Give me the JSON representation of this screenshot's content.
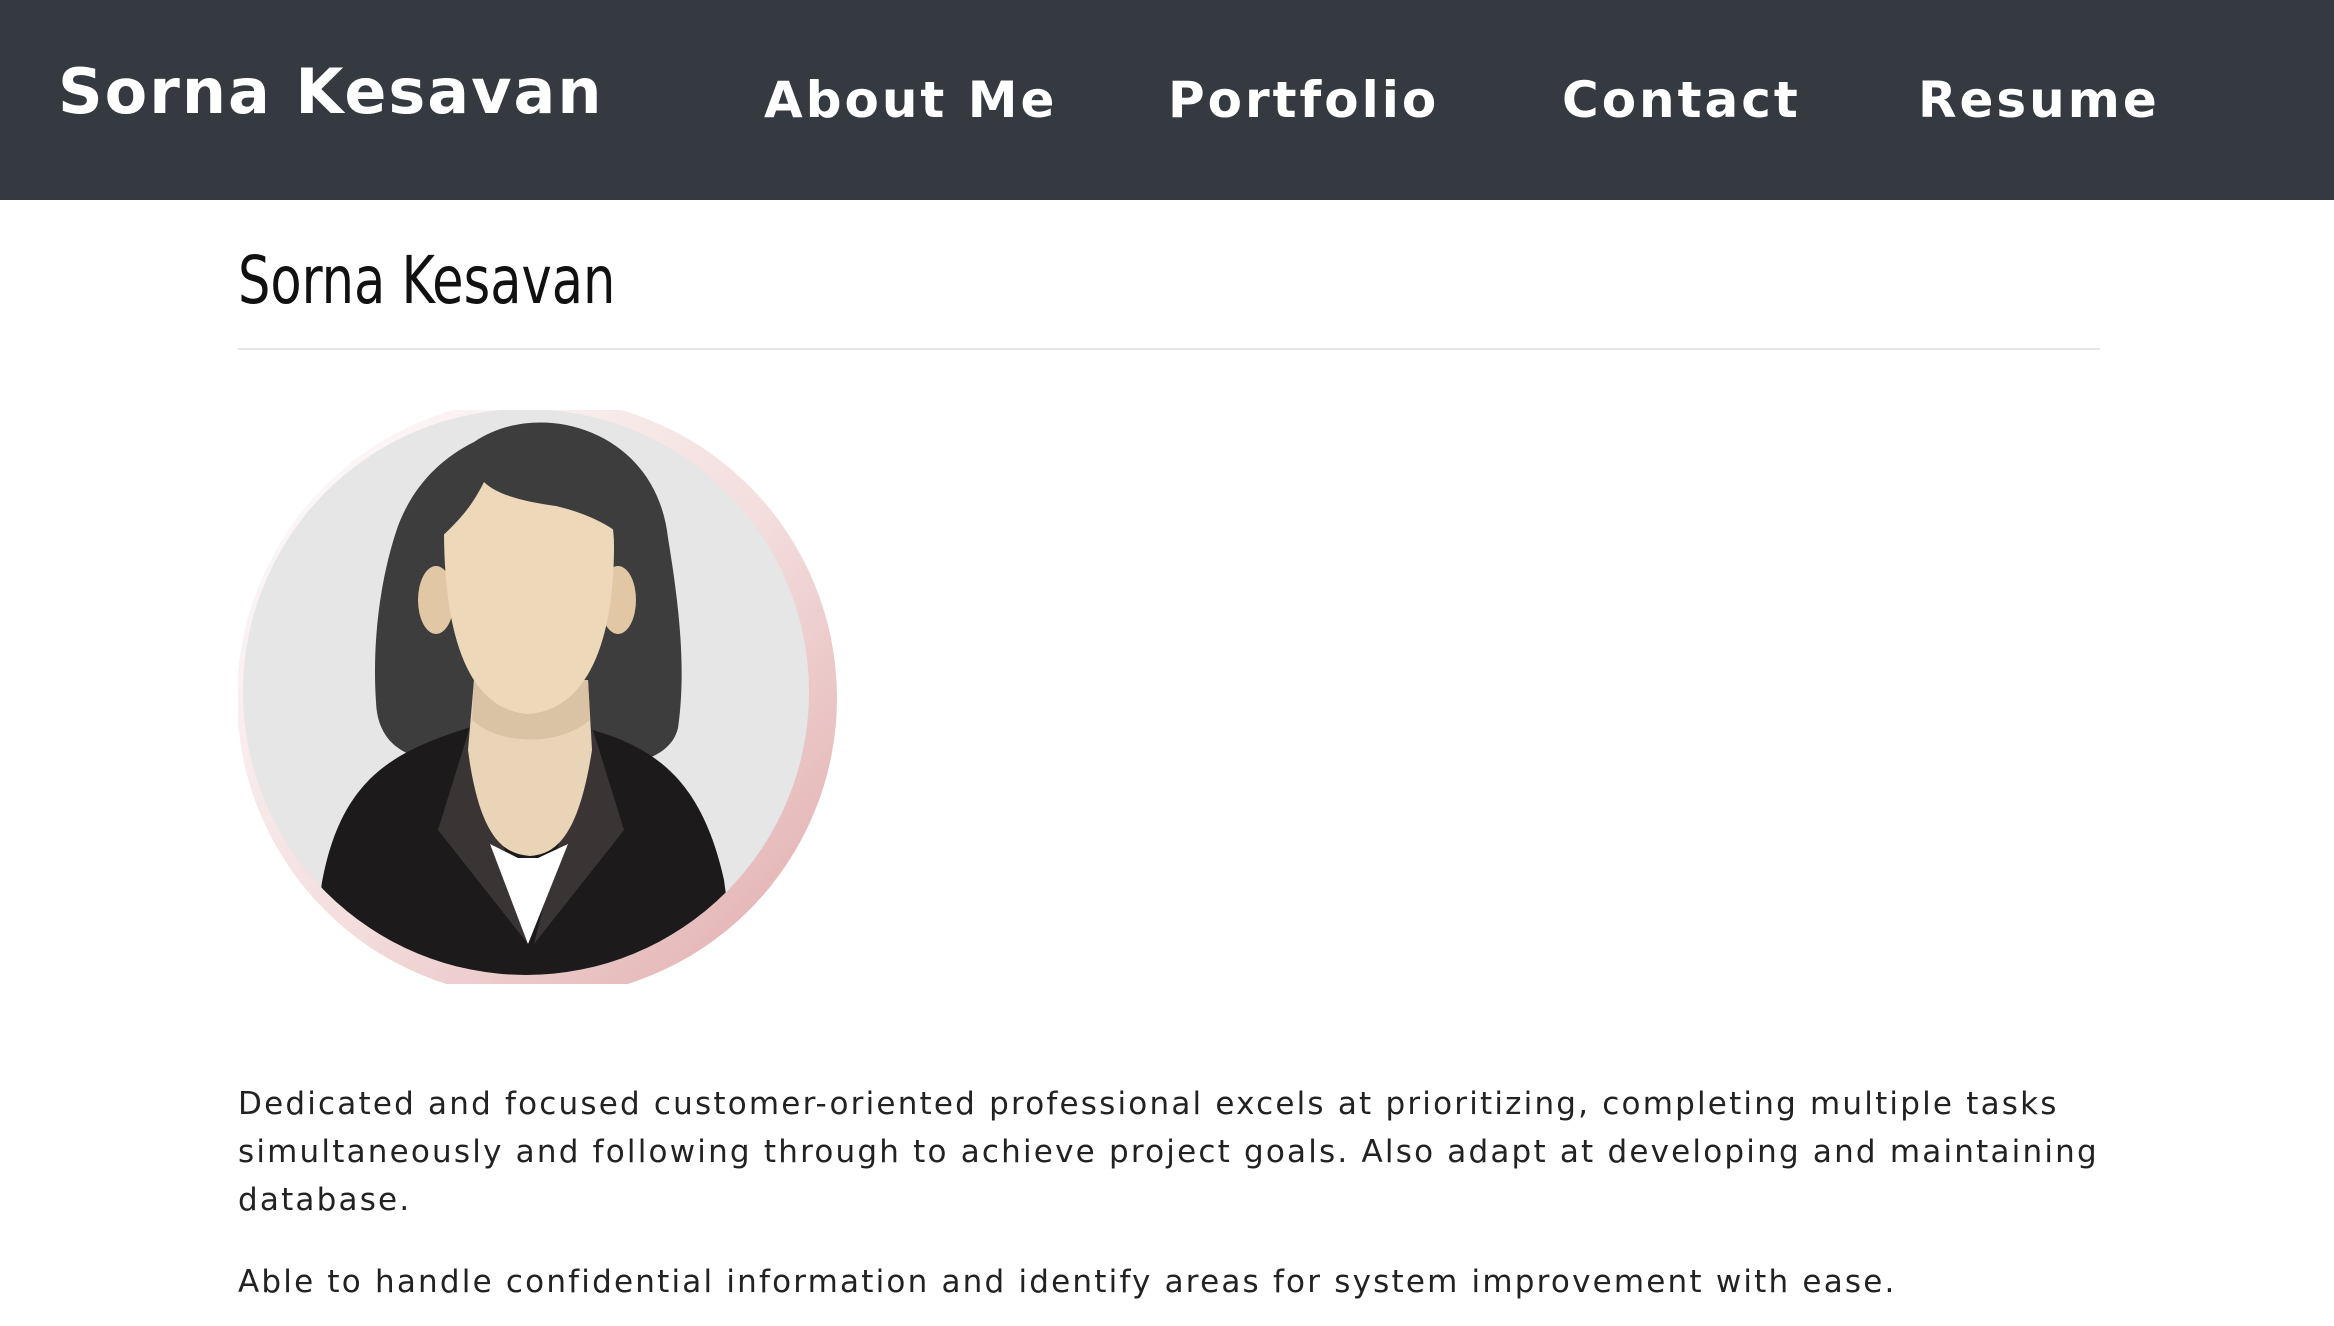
{
  "navbar": {
    "brand": "Sorna Kesavan",
    "links": [
      {
        "label": "About Me"
      },
      {
        "label": "Portfolio"
      },
      {
        "label": "Contact"
      },
      {
        "label": "Resume"
      }
    ],
    "background_color": "#343a3f",
    "text_color": "#ffffff"
  },
  "main": {
    "heading": "Sorna Kesavan",
    "avatar_icon": "woman-professional-avatar-icon",
    "bio_paragraphs": [
      "Dedicated and focused customer-oriented professional excels at prioritizing, completing multiple tasks simultaneously and following through to achieve project goals. Also adapt at developing and maintaining database.",
      "Able to handle confidential information and identify areas for system improvement with ease."
    ]
  }
}
